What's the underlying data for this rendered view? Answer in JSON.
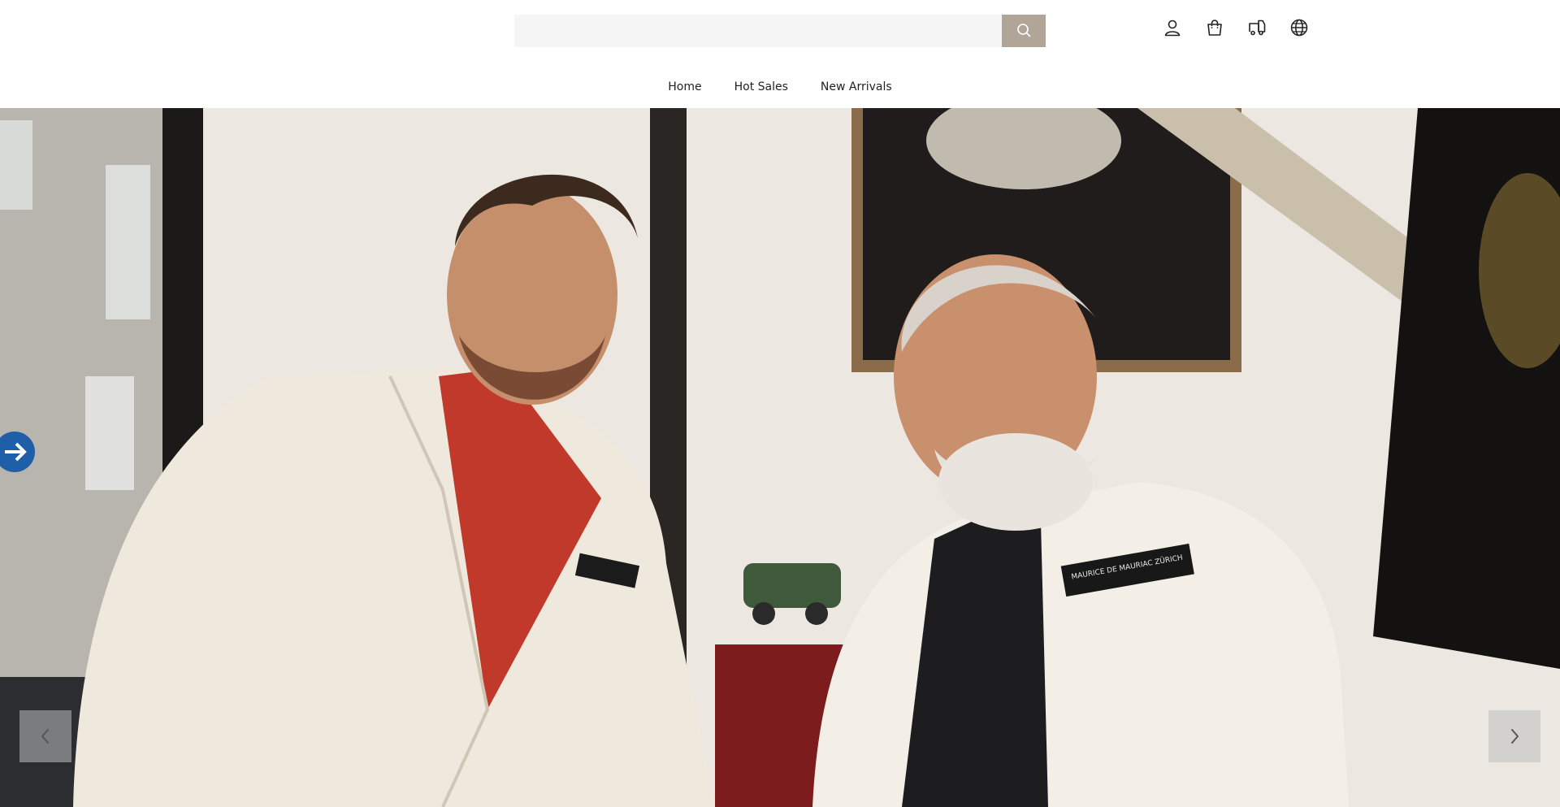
{
  "search": {
    "value": "",
    "placeholder": ""
  },
  "header_icons": [
    "user-icon",
    "shopping-bag-icon",
    "shipping-truck-icon",
    "globe-icon"
  ],
  "nav": {
    "items": [
      {
        "label": "Home"
      },
      {
        "label": "Hot Sales"
      },
      {
        "label": "New Arrivals"
      }
    ]
  },
  "hero": {
    "badge_text": "MAURICE DE MAURIAC ZÜRICH"
  },
  "colors": {
    "search_button": "#b0a596",
    "nav_text": "#222222"
  }
}
